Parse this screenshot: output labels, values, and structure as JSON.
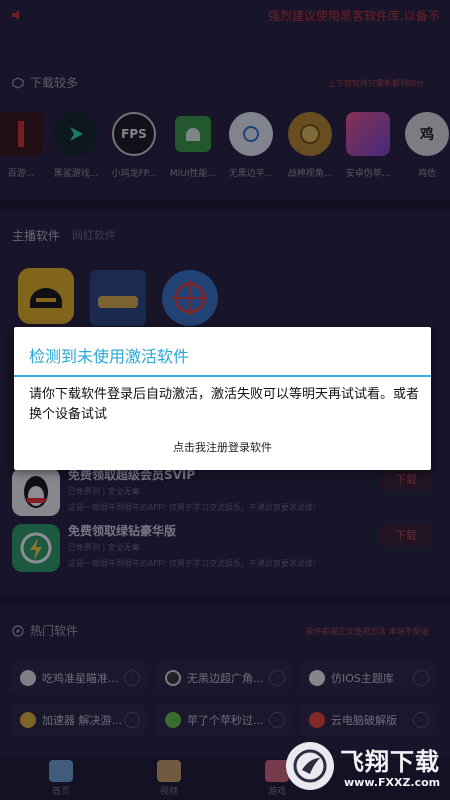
{
  "marquee": {
    "text": "强烈建议使用黑客软件库,以备不"
  },
  "download_section": {
    "title": "下载较多",
    "note": "上下双软件只需新都列印分",
    "items": [
      {
        "label": "百游...",
        "icon": "red-bar-icon",
        "color": "#3a1818"
      },
      {
        "label": "黑鲨游戏...",
        "icon": "play-arrow-icon",
        "color": "#1a2a2a"
      },
      {
        "label": "小鸡龙FP...",
        "icon": "fps-icon",
        "color": "#1e1e24"
      },
      {
        "label": "MIUI性能...",
        "icon": "android-icon",
        "color": "#3d9e4a"
      },
      {
        "label": "无黑边平...",
        "icon": "blue-circle-icon",
        "color": "#e8eef6"
      },
      {
        "label": "战神视角...",
        "icon": "medal-icon",
        "color": "#b98a2c"
      },
      {
        "label": "安卓伪苹...",
        "icon": "iphone-icon",
        "color": "#d64c7c"
      },
      {
        "label": "鸡信",
        "icon": "chicken-text-icon",
        "color": "#e0e0e0"
      }
    ]
  },
  "streamer_section": {
    "title": "主播软件",
    "subtitle": "网红软件"
  },
  "vip_cards": [
    {
      "title": "免费领取超级会员SVIP",
      "meta": "已免费测 | 安全无毒",
      "desc": "这是一款很牛到很牛的APP! 仅用于学习交流娱乐，不建议良要求法律!",
      "button": "下载",
      "icon": "qq-penguin-icon"
    },
    {
      "title": "免费领取绿钻豪华版",
      "meta": "已免费测 | 安全无毒",
      "desc": "这是一款很牛到很牛的APP! 仅用于学习交流娱乐，不建议良要求法律!",
      "button": "下载",
      "icon": "green-diamond-icon"
    }
  ],
  "hot_section": {
    "title": "热门软件",
    "note": "软件都是正文使用方法 本站不保证",
    "buttons": [
      {
        "label": "吃鸡准星瞄准...",
        "icon": "crosshair-icon"
      },
      {
        "label": "无黑边超广角...",
        "icon": "widescreen-icon"
      },
      {
        "label": "仿IOS主题库",
        "icon": "apple-icon"
      },
      {
        "label": "加速器 解决游...",
        "icon": "speed-icon"
      },
      {
        "label": "苹了个苹秒过...",
        "icon": "leaf-icon"
      },
      {
        "label": "云电脑破解版",
        "icon": "cloud-icon"
      }
    ]
  },
  "bottom_nav": [
    {
      "label": "首页",
      "icon": "home-icon"
    },
    {
      "label": "视频",
      "icon": "video-icon"
    },
    {
      "label": "游戏",
      "icon": "game-icon"
    }
  ],
  "dialog": {
    "title": "检测到未使用激活软件",
    "message": "请你下载软件登录后自动激活，激活失败可以等明天再试试看。或者换个设备试试",
    "action": "点击我注册登录软件"
  },
  "watermark": {
    "big": "飞翔下载",
    "small": "www.FXXZ.com"
  }
}
